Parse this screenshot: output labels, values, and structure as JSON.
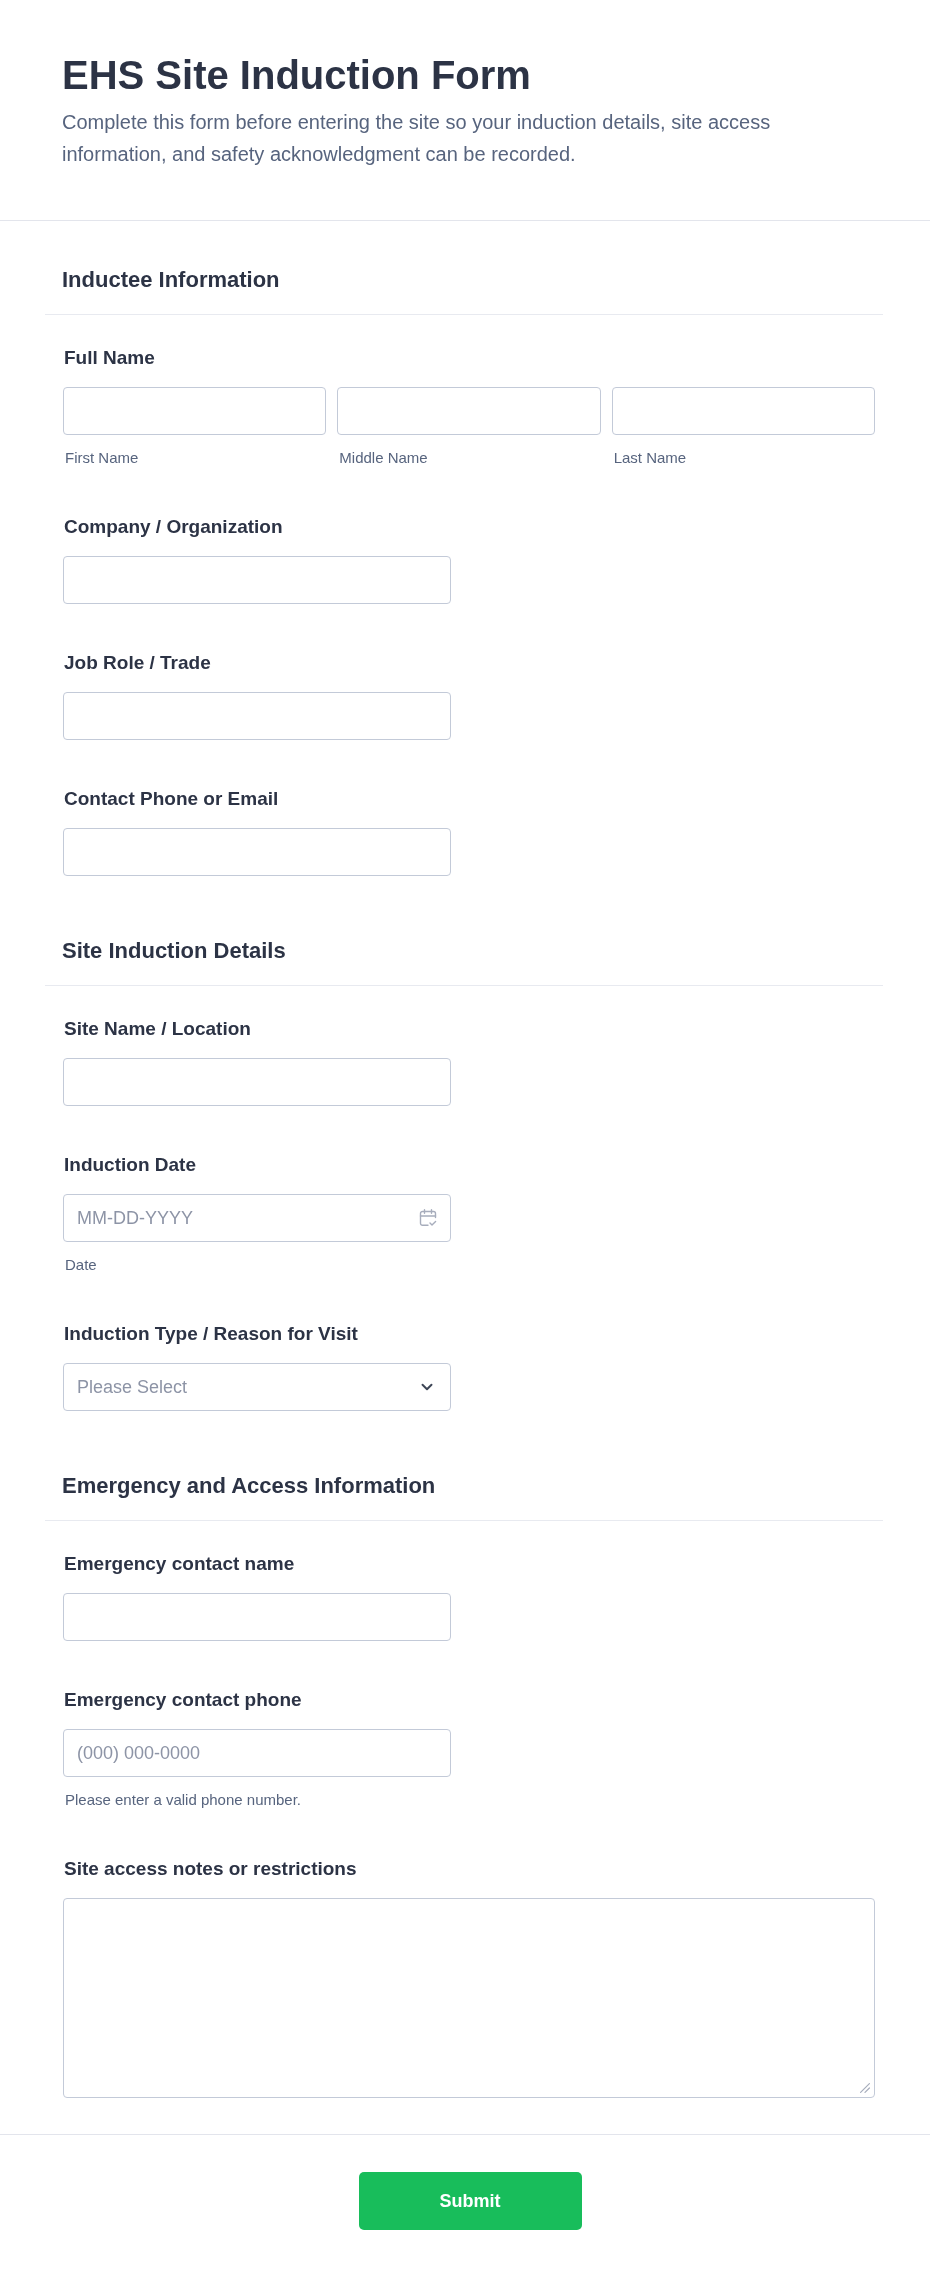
{
  "header": {
    "title": "EHS Site Induction Form",
    "description": "Complete this form before entering the site so your induction details, site access information, and safety acknowledgment can be recorded."
  },
  "sections": [
    {
      "title": "Inductee Information",
      "fields": [
        {
          "kind": "name",
          "label": "Full Name",
          "parts": [
            {
              "sublabel": "First Name"
            },
            {
              "sublabel": "Middle Name"
            },
            {
              "sublabel": "Last Name"
            }
          ]
        },
        {
          "kind": "text",
          "label": "Company / Organization"
        },
        {
          "kind": "text",
          "label": "Job Role / Trade"
        },
        {
          "kind": "text",
          "label": "Contact Phone or Email"
        }
      ]
    },
    {
      "title": "Site Induction Details",
      "fields": [
        {
          "kind": "text",
          "label": "Site Name / Location"
        },
        {
          "kind": "date",
          "label": "Induction Date",
          "placeholder": "MM-DD-YYYY",
          "sublabel": "Date"
        },
        {
          "kind": "select",
          "label": "Induction Type / Reason for Visit",
          "placeholder": "Please Select"
        }
      ]
    },
    {
      "title": "Emergency and Access Information",
      "fields": [
        {
          "kind": "text",
          "label": "Emergency contact name"
        },
        {
          "kind": "text",
          "label": "Emergency contact phone",
          "placeholder": "(000) 000-0000",
          "sublabel": "Please enter a valid phone number."
        },
        {
          "kind": "textarea",
          "label": "Site access notes or restrictions"
        }
      ]
    }
  ],
  "submit_button": {
    "label": "Submit"
  }
}
